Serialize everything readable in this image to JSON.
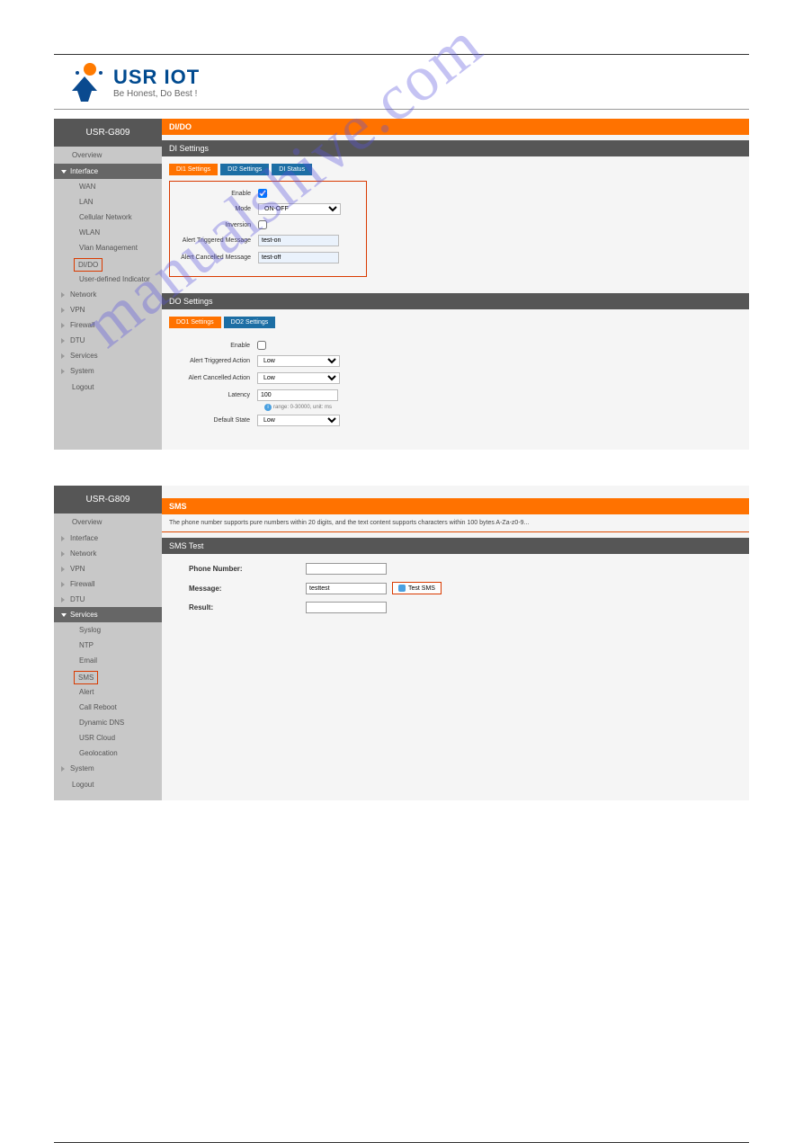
{
  "logo": {
    "main": "USR IOT",
    "sub": "Be Honest, Do Best !"
  },
  "panel1": {
    "title": "USR-G809",
    "sidebar": {
      "overview": "Overview",
      "interface": "Interface",
      "subs": [
        "WAN",
        "LAN",
        "Cellular Network",
        "WLAN",
        "Vlan Management",
        "DI/DO",
        "User-defined Indicator"
      ],
      "groups": [
        "Network",
        "VPN",
        "Firewall",
        "DTU",
        "Services",
        "System"
      ],
      "logout": "Logout"
    },
    "header": "DI/DO",
    "di": {
      "title": "DI Settings",
      "tabs": [
        "DI1 Settings",
        "DI2 Settings",
        "DI Status"
      ],
      "rows": {
        "enable": "Enable",
        "enable_v": true,
        "mode": "Mode",
        "mode_v": "ON-OFF",
        "inversion": "Inversion",
        "inversion_v": false,
        "atm": "Alert Triggered Message",
        "atm_v": "test-on",
        "acm": "Alert Cancelled Message",
        "acm_v": "test-off"
      }
    },
    "do": {
      "title": "DO Settings",
      "tabs": [
        "DO1 Settings",
        "DO2 Settings"
      ],
      "rows": {
        "enable": "Enable",
        "enable_v": false,
        "ata": "Alert Triggered Action",
        "ata_v": "Low",
        "aca": "Alert Cancelled Action",
        "aca_v": "Low",
        "lat": "Latency",
        "lat_v": "100",
        "lat_hint": "range: 0-30000, unit: ms",
        "def": "Default State",
        "def_v": "Low"
      }
    }
  },
  "panel2": {
    "title": "USR-G809",
    "sidebar": {
      "overview": "Overview",
      "groups_top": [
        "Interface",
        "Network",
        "VPN",
        "Firewall",
        "DTU"
      ],
      "services": "Services",
      "subs": [
        "Syslog",
        "NTP",
        "Email",
        "SMS",
        "Alert",
        "Call Reboot",
        "Dynamic DNS",
        "USR Cloud",
        "Geolocation"
      ],
      "groups_bottom": [
        "System"
      ],
      "logout": "Logout"
    },
    "header": "SMS",
    "note": "The phone number supports pure numbers within 20 digits, and the text content supports characters within 100 bytes A-Za-z0-9...",
    "test": {
      "title": "SMS Test",
      "phone_l": "Phone Number:",
      "phone_v": "",
      "msg_l": "Message:",
      "msg_v": "testtest",
      "btn": "Test SMS",
      "res_l": "Result:",
      "res_v": ""
    }
  },
  "watermark": "manualshive.com"
}
